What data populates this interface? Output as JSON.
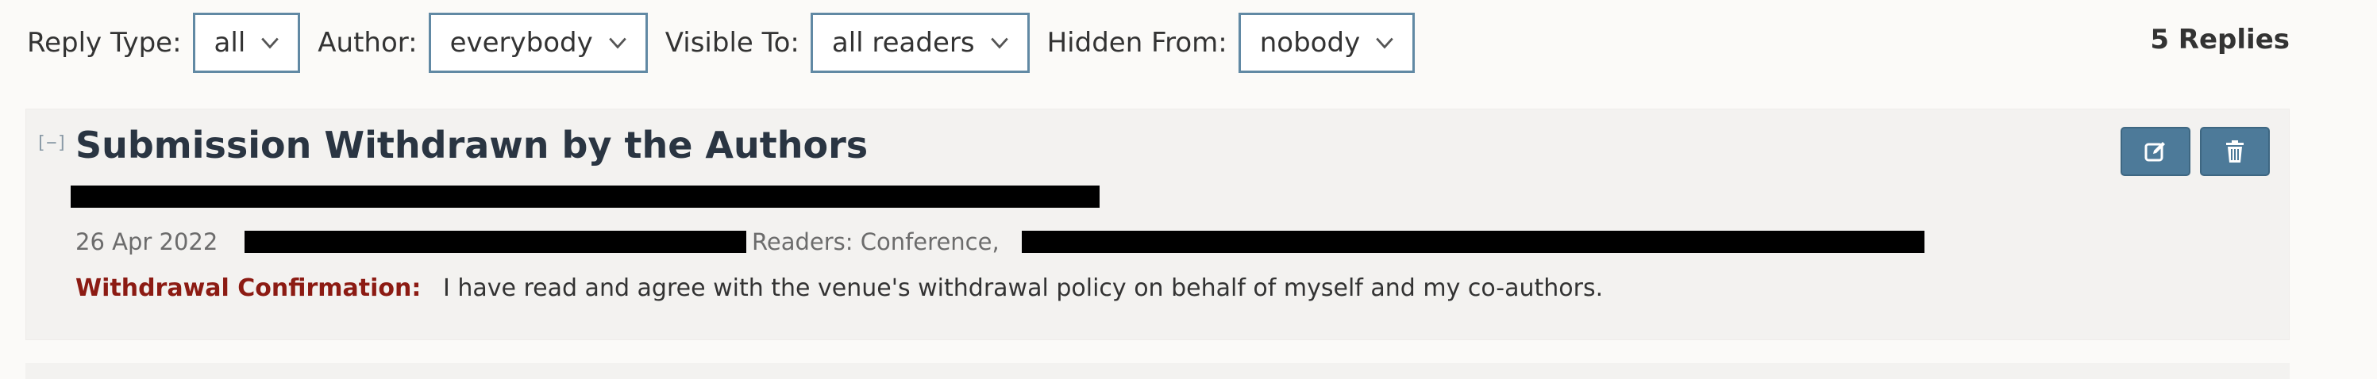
{
  "filters": {
    "reply_type": {
      "label": "Reply Type:",
      "value": "all"
    },
    "author": {
      "label": "Author:",
      "value": "everybody"
    },
    "visible_to": {
      "label": "Visible To:",
      "value": "all readers"
    },
    "hidden_from": {
      "label": "Hidden From:",
      "value": "nobody"
    }
  },
  "reply_count": "5 Replies",
  "note": {
    "collapse_toggle": "[−]",
    "title": "Submission Withdrawn by the Authors",
    "date": "26 Apr 2022",
    "readers_label": "Readers: Conference,",
    "fields": [
      {
        "name": "Withdrawal Confirmation:",
        "value": "I have read and agree with the venue's withdrawal policy on behalf of myself and my co-authors."
      }
    ],
    "actions": {
      "edit_icon": "edit-icon",
      "delete_icon": "trash-icon"
    }
  },
  "colors": {
    "accent": "#4d7a99",
    "select_border": "#6189a4",
    "field_name": "#8c1b13",
    "title": "#2a3542"
  }
}
